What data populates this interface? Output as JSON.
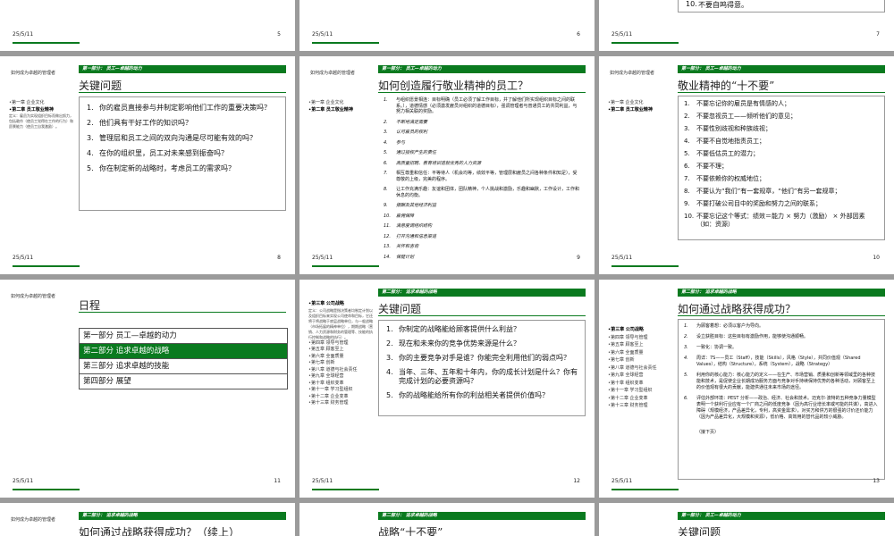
{
  "common": {
    "date": "25/5/11",
    "brand": "如何成为卓越的管理者"
  },
  "top_row": [
    {
      "num": "5"
    },
    {
      "num": "6"
    },
    {
      "num": "7",
      "item_n": "10.",
      "item": "不要自鸣得意。"
    }
  ],
  "slide8": {
    "section": "第一部分： 员工—卓越的动力",
    "title": "关键问题",
    "num": "8",
    "side_ch1": "•第一章 企业文化",
    "side_ch2": "•第二章 员工敬业精神",
    "side_desc": "定义：雇员为实现组织目标而做出努力，包括敢作（使员工觉得在工作的行为）和愿景能力（使员工自我激励）。",
    "items": [
      {
        "n": "1.",
        "t": "你的雇员直接参与并制定影响他们工作的重要决策吗？"
      },
      {
        "n": "2.",
        "t": "他们具有干好工作的知识吗？"
      },
      {
        "n": "3.",
        "t": "管理层和员工之间的双向沟通是尽可能有效的吗？"
      },
      {
        "n": "4.",
        "t": "在你的组织里，员工对未来感到振奋吗？"
      },
      {
        "n": "5.",
        "t": "你在制定新的战略时，考虑员工的需求吗？"
      }
    ]
  },
  "slide9": {
    "section": "第一部分： 员工—卓越的动力",
    "title": "如何创造履行敬业精神的员工？",
    "num": "9",
    "side_ch1": "•第一章 企业文化",
    "side_ch2": "•第二章 员工敬业精神",
    "items": [
      {
        "n": "1.",
        "t": "与组织愿景相连：目标明确（员工必须了解工作目标，并了解他们所实现组织目标之间的联系。），道德情感（必须激发雇员对组织的道德目标），强调管理者与普通员工的共同利益，与努力相关联的奖励。"
      },
      {
        "n": "2.",
        "t": "不断地满足需要"
      },
      {
        "n": "3.",
        "t": "认可雇员的权利"
      },
      {
        "n": "4.",
        "t": "参与"
      },
      {
        "n": "5.",
        "t": "通过授权产生的责任"
      },
      {
        "n": "6.",
        "t": "高质量招聘、教育培训造就优秀的人力资源"
      },
      {
        "n": "7.",
        "t": "相互尊重和信任：平等待人（机会均等，绩效平等，管理层和雇员之间各种条件和知足），受尊敬的上级，完美的程序。"
      },
      {
        "n": "8.",
        "t": "让工作充满乐趣：友谊和团体，团队精神，个人挑战和激励，乐趣和幽默，工作设计，工作和休息的均衡。"
      },
      {
        "n": "9.",
        "t": "报酬及其他经济利益"
      },
      {
        "n": "10.",
        "t": "雇佣保障"
      },
      {
        "n": "11.",
        "t": "满意度调组织结构"
      },
      {
        "n": "12.",
        "t": "打开沟通和信息渠道"
      },
      {
        "n": "13.",
        "t": "关怀和咨询"
      },
      {
        "n": "14.",
        "t": "保健计划"
      }
    ]
  },
  "slide10": {
    "section": "第一部分： 员工—卓越的动力",
    "title": "敬业精神的“十不要”",
    "num": "10",
    "side_ch1": "•第一章 企业文化",
    "side_ch2": "•第二章 员工敬业精神",
    "items": [
      {
        "n": "1.",
        "t": "不要忘记你的雇员是有情感的人；"
      },
      {
        "n": "2.",
        "t": "不要忽视员工——倾听他们的意见；"
      },
      {
        "n": "3.",
        "t": "不要性别歧视和种族歧视；"
      },
      {
        "n": "4.",
        "t": "不要不自觉地指责员工；"
      },
      {
        "n": "5.",
        "t": "不要低估员工的潜力；"
      },
      {
        "n": "6.",
        "t": "不要不理；"
      },
      {
        "n": "7.",
        "t": "不要依赖你的权威地位；"
      },
      {
        "n": "8.",
        "t": "不要认为“我们”有一套规章，“他们”有另一套规章；"
      },
      {
        "n": "9.",
        "t": "不要打破公司目中的奖励和努力之间的联系；"
      },
      {
        "n": "10.",
        "t": "不要忘记这个等式：绩效＝能力 × 努力（激励） × 外部因素（如：资源）"
      }
    ]
  },
  "slide11": {
    "title": "日程",
    "num": "11",
    "agenda": [
      "第一部分 员工—卓越的动力",
      "第二部分 追求卓越的战略",
      "第三部分 追求卓越的技能",
      "第四部分 展望"
    ]
  },
  "slide12": {
    "section": "第二部分： 追求卓越的战略",
    "title": "关键问题",
    "num": "12",
    "side_cur": "•第三章 公司战略",
    "side_desc": "定义：公司战略是指决策者均制定计划以及组织目标来实现公司使命和目标，它还将于将战略于底层战略单位，与一般战略（市场拓展的精神单位），期期战略（营销、人力资源和财务的管理等、技能的执行控制和战略的执行）。",
    "side_items": [
      "•第四章 领导与管理",
      "•第五章 顾客至上",
      "•第六章 全面质量",
      "•第七章 创新",
      "•第八章 道德与社会责任",
      "•第九章 全球经营",
      "•第十章 组织变革",
      "•第十一章 学习型组织",
      "•第十二章 企业变革",
      "•第十三章 财务管理"
    ],
    "items": [
      {
        "n": "1.",
        "t": "你制定的战略能给顾客提供什么利益？"
      },
      {
        "n": "2.",
        "t": "现在和未来你的竞争优势来源是什么？"
      },
      {
        "n": "3.",
        "t": "你的主要竞争对手是谁？你能完全利用他们的弱点吗？"
      },
      {
        "n": "4.",
        "t": "当年、三年、五年和十年内，你的成长计划是什么？你有完成计划的必要资源吗？"
      },
      {
        "n": "5.",
        "t": "你的战略能给所有你的利益相关者提供价值吗？"
      }
    ]
  },
  "slide13": {
    "section": "第二部分： 追求卓越的战略",
    "title": "如何通过战略获得成功？",
    "num": "13",
    "side_cur": "•第三章 公司战略",
    "side_items": [
      "•第四章 领导与管理",
      "•第五章 顾客至上",
      "•第六章 全面质量",
      "•第七章 创新",
      "•第八章 道德与社会责任",
      "•第九章 全球经营",
      "•第十章 组织变革",
      "•第十一章 学习型组织",
      "•第十二章 企业变革",
      "•第十三章 财务管理"
    ],
    "items": [
      {
        "n": "1.",
        "t": "为顾客着想：必须以客户为导向。"
      },
      {
        "n": "2.",
        "t": "设立获胜目标：这些目标有激励作用，能够使沟通顺畅。"
      },
      {
        "n": "3.",
        "t": "一致化：协调一致。"
      },
      {
        "n": "4.",
        "t": "周详：7S——员工（Staff），技能（Skills），风格（Style），共同价值观（Shared Values），结构（Structure），系统（System），战略（Strategy）"
      },
      {
        "n": "5.",
        "t": "利用你的核心能力：核心能力的定义——在生产、市场营销、质量和创新等领域里的各种技能和技术，是促使企业长期成功服务方面与竞争对手持续保持优势的各种活动，对顾客至上的价值观有很大的贡献，能建供通往未来市场的途径。"
      },
      {
        "n": "6.",
        "t": "评估外部环境：PEST 分析——政治、经济、社会和技术。迈克尔·波特的五种竞争力量模型表明一个获利行业应有一个厂商之间的低度竞争（因为高行业增长率或可能的共谋），高进入障碍（规模经济，产品差异化，专利，高资金需求），对买方和供方的很强的讨价还价能力（因为产品差异化，大规模和资源），低价格、高效用的替代品的较小威胁。"
      }
    ],
    "cont": "（接下页）"
  },
  "bottom_row": [
    {
      "section": "第二部分： 追求卓越的战略",
      "title": "如何通过战略获得成功？（续上）"
    },
    {
      "section": "第二部分： 追求卓越的战略",
      "title": "战略“十不要”"
    },
    {
      "section": "第一部分： 员工—卓越的动力",
      "title": "关键问题"
    }
  ]
}
